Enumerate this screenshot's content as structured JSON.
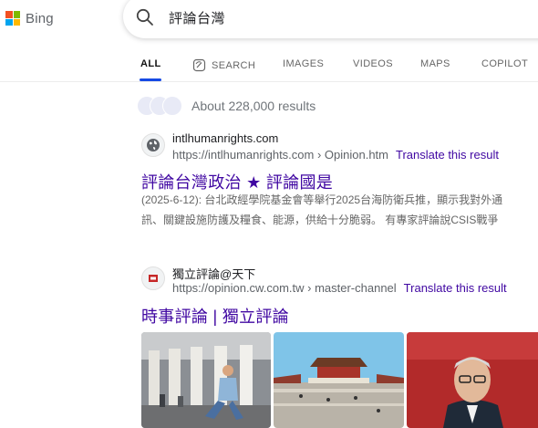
{
  "header": {
    "brand": "Bing",
    "query": "評論台灣"
  },
  "tabs": [
    {
      "label": "ALL",
      "icon": null,
      "active": true
    },
    {
      "label": "SEARCH",
      "icon": "copilot-search-icon",
      "active": false
    },
    {
      "label": "IMAGES",
      "icon": null,
      "active": false
    },
    {
      "label": "VIDEOS",
      "icon": null,
      "active": false
    },
    {
      "label": "MAPS",
      "icon": null,
      "active": false
    },
    {
      "label": "COPILOT",
      "icon": null,
      "active": false
    }
  ],
  "results_count": "About 228,000 results",
  "results": [
    {
      "site_name": "intlhumanrights.com",
      "url": "https://intlhumanrights.com › Opinion.htm",
      "translate": "Translate this result",
      "title": "評論台灣政治 ★ 評論國是",
      "snippet_line1": "(2025-6-12): 台北政經學院基金會等舉行2025台海防衛兵推，顯示我對外通",
      "snippet_line2": "訊、關鍵設施防護及糧食、能源，供給十分脆弱。 有專家評論說CSIS戰爭",
      "icon": "globe-icon"
    },
    {
      "site_name": "獨立評論@天下",
      "url": "https://opinion.cw.com.tw › master-channel",
      "translate": "Translate this result",
      "title": "時事評論 | 獨立評論",
      "icon": "cw-favicon-icon"
    }
  ],
  "colors": {
    "link_purple": "#4007a2",
    "accent_blue": "#174ae4",
    "ms_red": "#f25022",
    "ms_green": "#7fba00",
    "ms_blue": "#00a4ef",
    "ms_yellow": "#ffb900"
  }
}
